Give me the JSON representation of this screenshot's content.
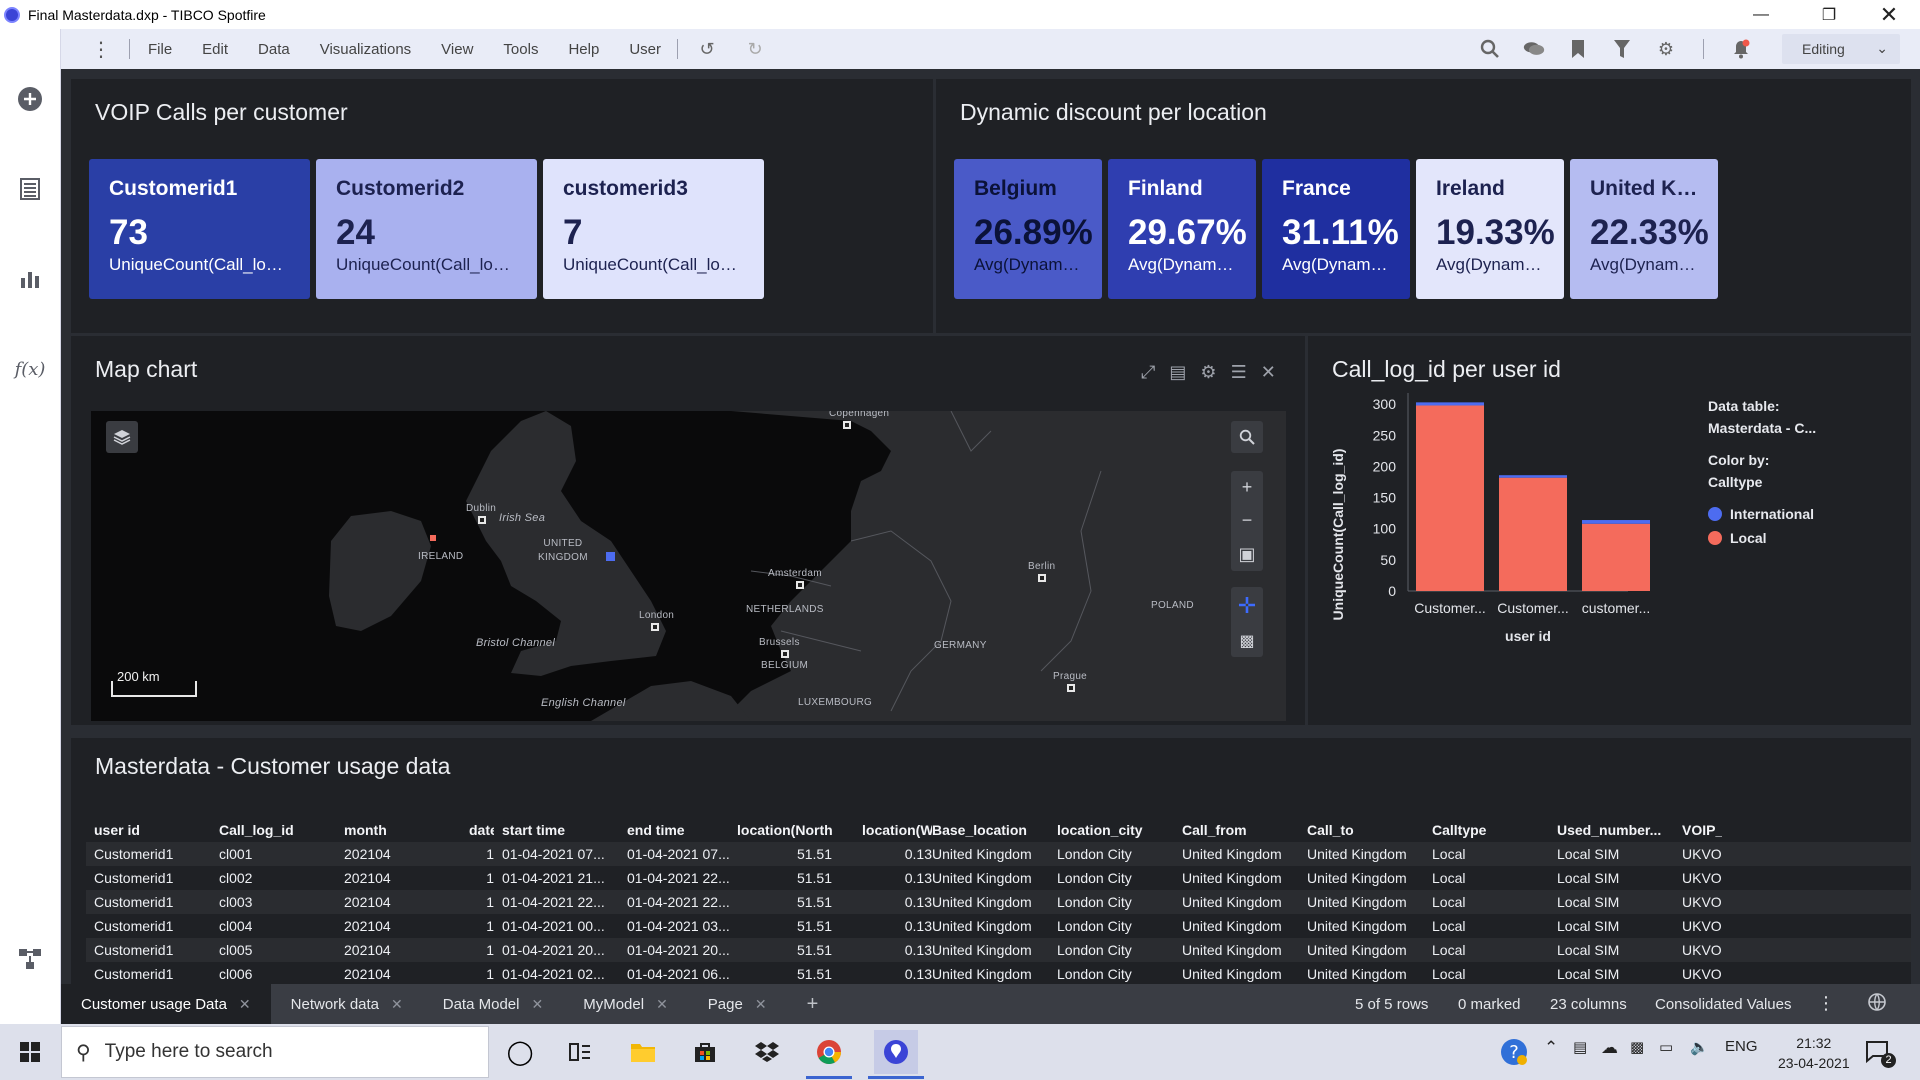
{
  "window": {
    "title": "Final Masterdata.dxp - TIBCO Spotfire",
    "minimize_icon": "minimize-icon",
    "restore_icon": "restore-icon",
    "close_icon": "close-icon"
  },
  "menubar": {
    "items": [
      "File",
      "Edit",
      "Data",
      "Visualizations",
      "View",
      "Tools",
      "Help",
      "User"
    ],
    "mode": "Editing"
  },
  "voip_panel": {
    "title": "VOIP Calls per customer",
    "cards": [
      {
        "title": "Customerid1",
        "value": "73",
        "sub": "UniqueCount(Call_log_id)",
        "bg": "#2a3fa6",
        "fg": "#ffffff"
      },
      {
        "title": "Customerid2",
        "value": "24",
        "sub": "UniqueCount(Call_log_id)",
        "bg": "#a9b1ef",
        "fg": "#1d2250"
      },
      {
        "title": "customerid3",
        "value": "7",
        "sub": "UniqueCount(Call_log_id)",
        "bg": "#dfe3fc",
        "fg": "#1d2250"
      }
    ]
  },
  "discount_panel": {
    "title": "Dynamic discount per location",
    "cards": [
      {
        "title": "Belgium",
        "value": "26.89%",
        "sub": "Avg(Dynamic Dis...",
        "bg": "#4a5ac8",
        "fg": "#0b1238"
      },
      {
        "title": "Finland",
        "value": "29.67%",
        "sub": "Avg(Dynamic Dis...",
        "bg": "#2f3eb0",
        "fg": "#ffffff"
      },
      {
        "title": "France",
        "value": "31.11%",
        "sub": "Avg(Dynamic Dis...",
        "bg": "#1f2fa0",
        "fg": "#ffffff"
      },
      {
        "title": "Ireland",
        "value": "19.33%",
        "sub": "Avg(Dynamic Dis...",
        "bg": "#e3e6fb",
        "fg": "#1d2250"
      },
      {
        "title": "United King...",
        "value": "22.33%",
        "sub": "Avg(Dynamic Dis...",
        "bg": "#b5bcf1",
        "fg": "#1d2250"
      }
    ]
  },
  "map_panel": {
    "title": "Map chart",
    "scale": "200 km",
    "labels": {
      "copenhagen": "Copenhagen",
      "dublin": "Dublin",
      "irish_sea": "Irish Sea",
      "ireland": "IRELAND",
      "uk": "UNITED\nKINGDOM",
      "london": "London",
      "bristol": "Bristol Channel",
      "english_channel": "English Channel",
      "amsterdam": "Amsterdam",
      "netherlands": "NETHERLANDS",
      "brussels": "Brussels",
      "belgium": "BELGIUM",
      "luxembourg": "LUXEMBOURG",
      "berlin": "Berlin",
      "germany": "GERMANY",
      "poland": "POLAND",
      "prague": "Prague"
    }
  },
  "bar_panel": {
    "title": "Call_log_id per user id",
    "legend_table_label": "Data table:",
    "legend_table_value": "Masterdata - C...",
    "legend_color_label": "Color by:",
    "legend_color_value": "Calltype",
    "legend_series": [
      {
        "name": "International",
        "color": "#4d6cf0"
      },
      {
        "name": "Local",
        "color": "#f46b5c"
      }
    ]
  },
  "chart_data": {
    "type": "bar",
    "stacked": true,
    "categories": [
      "Customer...",
      "Customer...",
      "customer..."
    ],
    "series": [
      {
        "name": "Local",
        "values": [
          298,
          182,
          108
        ]
      },
      {
        "name": "International",
        "values": [
          5,
          4,
          6
        ]
      }
    ],
    "xlabel": "user id",
    "ylabel": "UniqueCount(Call_log_id)",
    "ylim": [
      0,
      310
    ],
    "yticks": [
      0,
      50,
      100,
      150,
      200,
      250,
      300
    ]
  },
  "table_panel": {
    "title": "Masterdata - Customer usage data",
    "columns": [
      "user id",
      "Call_log_id",
      "month",
      "date",
      "start time",
      "end time",
      "location(North)",
      "location(West)",
      "Base_location",
      "location_city",
      "Call_from",
      "Call_to",
      "Calltype",
      "Used_number...",
      "VOIP_"
    ],
    "rows": [
      [
        "Customerid1",
        "cl001",
        "202104",
        "1",
        "01-04-2021 07...",
        "01-04-2021 07...",
        "51.51",
        "0.13",
        "United Kingdom",
        "London City",
        "United Kingdom",
        "United Kingdom",
        "Local",
        "Local SIM",
        "UKVO"
      ],
      [
        "Customerid1",
        "cl002",
        "202104",
        "1",
        "01-04-2021 21...",
        "01-04-2021 22...",
        "51.51",
        "0.13",
        "United Kingdom",
        "London City",
        "United Kingdom",
        "United Kingdom",
        "Local",
        "Local SIM",
        "UKVO"
      ],
      [
        "Customerid1",
        "cl003",
        "202104",
        "1",
        "01-04-2021 22...",
        "01-04-2021 22...",
        "51.51",
        "0.13",
        "United Kingdom",
        "London City",
        "United Kingdom",
        "United Kingdom",
        "Local",
        "Local SIM",
        "UKVO"
      ],
      [
        "Customerid1",
        "cl004",
        "202104",
        "1",
        "01-04-2021 00...",
        "01-04-2021 03...",
        "51.51",
        "0.13",
        "United Kingdom",
        "London City",
        "United Kingdom",
        "United Kingdom",
        "Local",
        "Local SIM",
        "UKVO"
      ],
      [
        "Customerid1",
        "cl005",
        "202104",
        "1",
        "01-04-2021 20...",
        "01-04-2021 20...",
        "51.51",
        "0.13",
        "United Kingdom",
        "London City",
        "United Kingdom",
        "United Kingdom",
        "Local",
        "Local SIM",
        "UKVO"
      ],
      [
        "Customerid1",
        "cl006",
        "202104",
        "1",
        "01-04-2021 02...",
        "01-04-2021 06...",
        "51.51",
        "0.13",
        "United Kingdom",
        "London City",
        "United Kingdom",
        "United Kingdom",
        "Local",
        "Local SIM",
        "UKVO"
      ]
    ]
  },
  "tabs": {
    "items": [
      "Customer usage Data",
      "Network data",
      "Data Model",
      "MyModel",
      "Page"
    ],
    "active": "Customer usage Data",
    "rows_status": "5 of 5 rows",
    "marked_status": "0 marked",
    "columns_status": "23 columns",
    "values_status": "Consolidated Values"
  },
  "taskbar": {
    "search_placeholder": "Type here to search",
    "language": "ENG",
    "time": "21:32",
    "date": "23-04-2021",
    "notification_count": "2"
  }
}
